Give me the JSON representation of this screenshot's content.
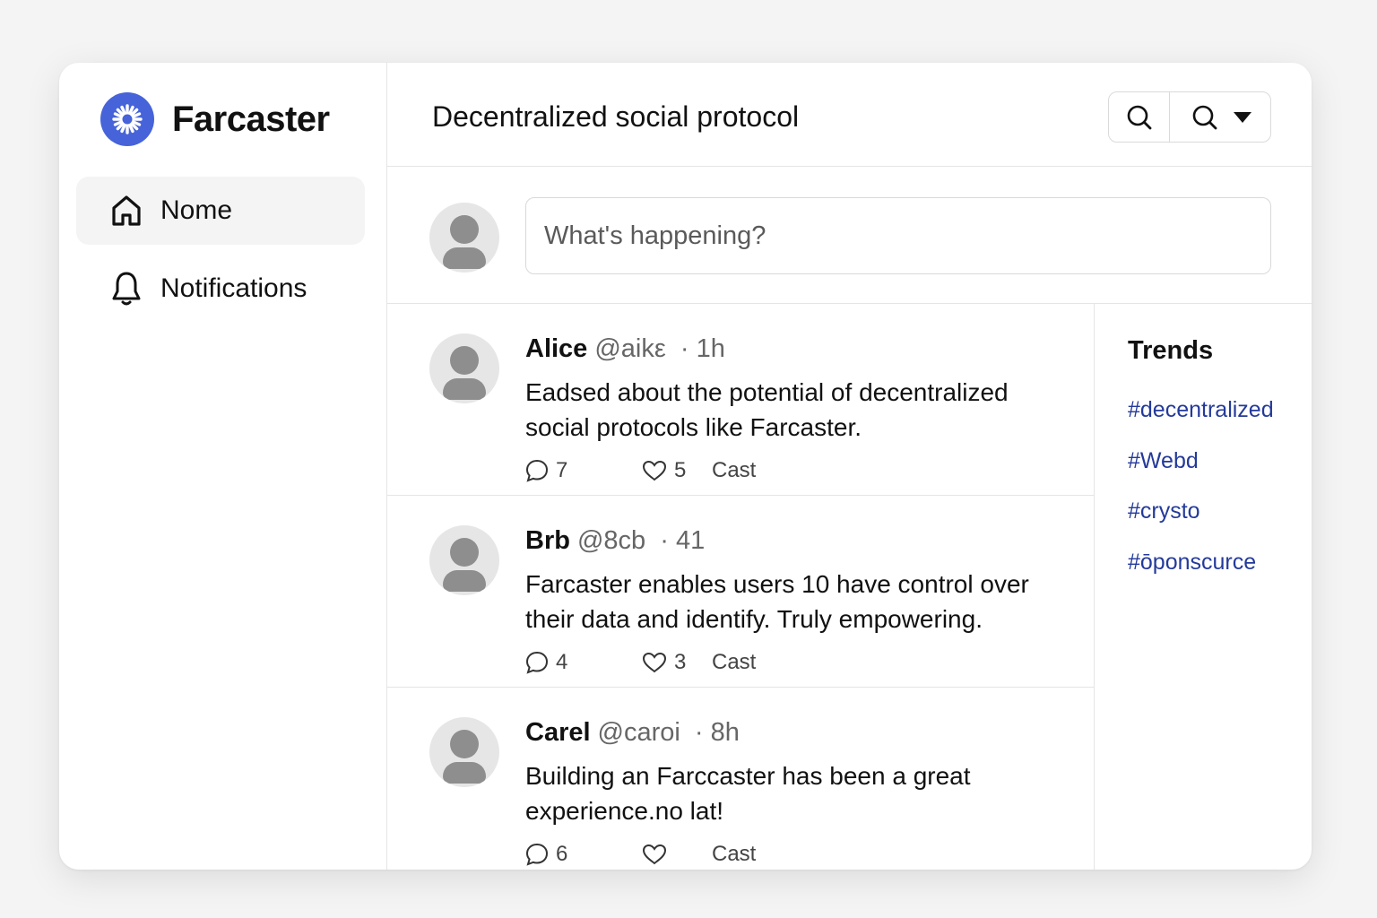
{
  "app": {
    "name": "Farcaster",
    "brand_color": "#4663d9"
  },
  "sidebar": {
    "items": [
      {
        "label": "Nome",
        "icon": "home-icon",
        "active": true
      },
      {
        "label": "Notifications",
        "icon": "bell-icon",
        "active": false
      }
    ]
  },
  "header": {
    "title": "Decentralized social protocol",
    "tools": [
      {
        "icon": "search-icon"
      },
      {
        "icon": "search-icon"
      },
      {
        "icon": "caret-down-icon"
      }
    ]
  },
  "composer": {
    "placeholder": "What's happening?"
  },
  "posts": [
    {
      "name": "Alice",
      "handle": "@aikε",
      "time": "1h",
      "body": "Eadsed about the potential of decentralized social protocols like Farcaster.",
      "replies": "7",
      "likes": "5",
      "cast_label": "Cast"
    },
    {
      "name": "Brb",
      "handle": "@8cb",
      "time": "41",
      "body": "Farcaster enables users 10 have control over their data and identify. Truly empowering.",
      "replies": "4",
      "likes": "3",
      "cast_label": "Cast"
    },
    {
      "name": "Carel",
      "handle": "@caroi",
      "time": "8h",
      "body": "Building an Farccaster has been a great experience.no lat!",
      "replies": "6",
      "likes": "",
      "cast_label": "Cast"
    }
  ],
  "trends": {
    "title": "Trends",
    "link_color": "#243a9a",
    "tags": [
      "#decentralized",
      "#Webd",
      "#crysto",
      "#ōponscurce"
    ]
  }
}
